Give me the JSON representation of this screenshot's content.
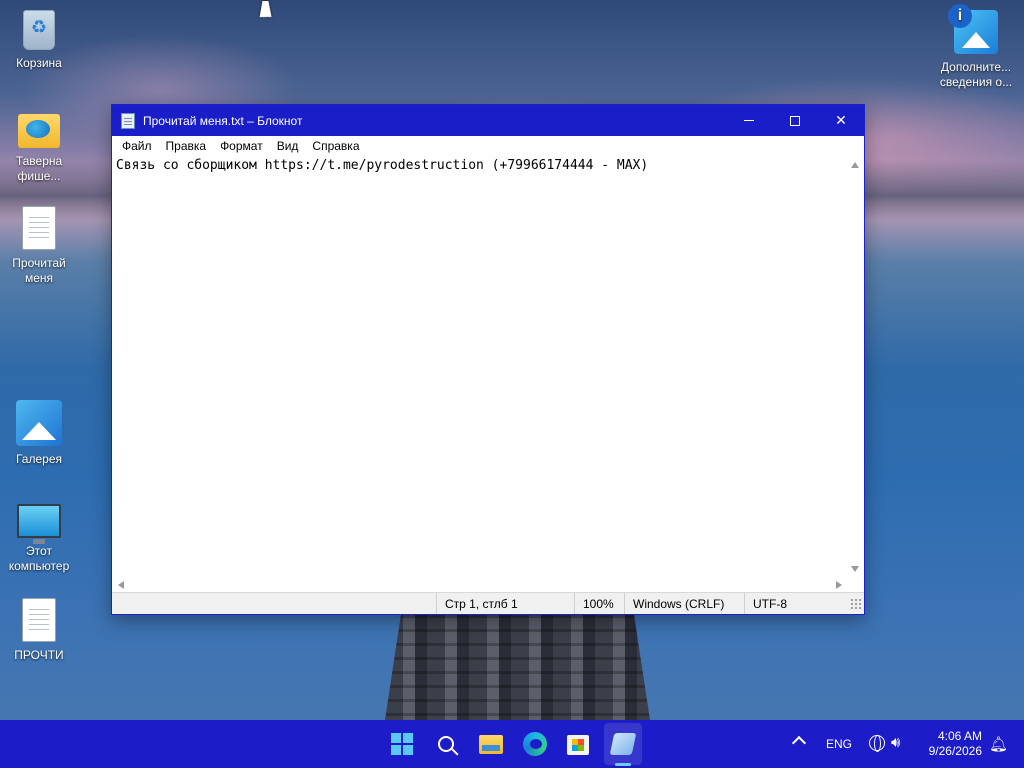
{
  "desktop": {
    "icons": [
      {
        "label": "Корзина",
        "icon": "recycle-bin-icon"
      },
      {
        "label": "Таверна фише...",
        "icon": "folder-icon"
      },
      {
        "label": "Прочитай меня",
        "icon": "text-document-icon"
      },
      {
        "label": "Галерея",
        "icon": "gallery-icon"
      },
      {
        "label": "Этот компьютер",
        "icon": "computer-icon"
      },
      {
        "label": "ПРОЧТИ",
        "icon": "text-document-icon"
      },
      {
        "label": "Дополните... сведения о...",
        "icon": "info-icon"
      }
    ]
  },
  "window": {
    "title": "Прочитай меня.txt – Блокнот",
    "menu": [
      "Файл",
      "Правка",
      "Формат",
      "Вид",
      "Справка"
    ],
    "content": "Связь со сборщиком https://t.me/pyrodestruction (+79966174444 - MAX)",
    "status": {
      "position": "Стр 1, стлб 1",
      "zoom": "100%",
      "line_ending": "Windows (CRLF)",
      "encoding": "UTF-8"
    }
  },
  "taskbar": {
    "apps": [
      "start-icon",
      "search-icon",
      "file-explorer-icon",
      "edge-icon",
      "store-icon",
      "notepad-icon"
    ],
    "active_app": "notepad-icon",
    "language": "ENG",
    "time": "4:06 AM",
    "date": "9/26/2026"
  },
  "colors": {
    "titlebar": "#1a1ec9",
    "taskbar": "#1c1cc8",
    "accent": "#5ac8fa"
  }
}
